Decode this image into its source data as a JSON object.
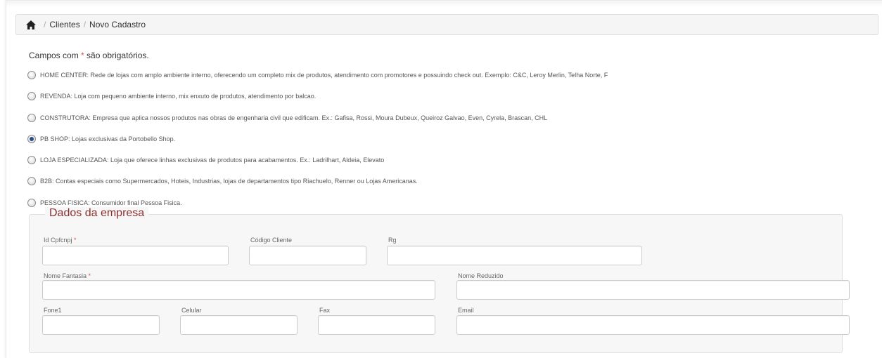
{
  "breadcrumb": {
    "items": [
      "Clientes",
      "Novo Cadastro"
    ],
    "separator": "/"
  },
  "form": {
    "required_prefix": "Campos com ",
    "required_star": "*",
    "required_suffix": " são obrigatórios.",
    "client_types": [
      {
        "label": "HOME CENTER: Rede de lojas com amplo ambiente interno, oferecendo um completo mix de produtos, atendimento com promotores e possuindo check out. Exemplo: C&C, Leroy Merlin, Telha Norte, F",
        "checked": false
      },
      {
        "label": "REVENDA: Loja com pequeno ambiente interno, mix enxuto de produtos, atendimento por balcao.",
        "checked": false
      },
      {
        "label": "CONSTRUTORA: Empresa que aplica nossos produtos nas obras de engenharia civil que edificam. Ex.: Gafisa, Rossi, Moura Dubeux, Queiroz Galvao, Even, Cyrela, Brascan, CHL",
        "checked": false
      },
      {
        "label": "PB SHOP: Lojas exclusivas da Portobello Shop.",
        "checked": true
      },
      {
        "label": "LOJA ESPECIALIZADA: Loja que oferece linhas exclusivas de produtos para acabamentos. Ex.: Ladrilhart, Aldeia, Elevato",
        "checked": false
      },
      {
        "label": "B2B: Contas especiais como Supermercados, Hoteis, Industrias, lojas de departamentos tipo Riachuelo, Renner ou Lojas Americanas.",
        "checked": false
      },
      {
        "label": "PESSOA FISICA: Consumidor final Pessoa Fisica.",
        "checked": false
      }
    ],
    "section_title": "Dados da empresa",
    "fields": {
      "id_cpfcnpj": {
        "label": "Id Cpfcnpj",
        "required": "*",
        "value": ""
      },
      "codigo_cliente": {
        "label": "Código Cliente",
        "value": ""
      },
      "rg": {
        "label": "Rg",
        "value": ""
      },
      "nome_fantasia": {
        "label": "Nome Fantasia",
        "required": "*",
        "value": ""
      },
      "nome_reduzido": {
        "label": "Nome Reduzido",
        "value": ""
      },
      "fone1": {
        "label": "Fone1",
        "value": ""
      },
      "celular": {
        "label": "Celular",
        "value": ""
      },
      "fax": {
        "label": "Fax",
        "value": ""
      },
      "email": {
        "label": "Email",
        "value": ""
      }
    }
  },
  "colors": {
    "required_star": "#d9534f",
    "legend_text": "#8b2e2e",
    "radio_checked": "#2a4f86"
  }
}
